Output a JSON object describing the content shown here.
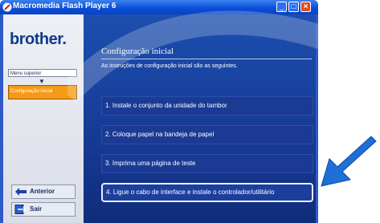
{
  "window": {
    "title": "Macromedia Flash Player 6",
    "title_colors": {
      "bar": "#0a4fd8",
      "close": "#e24b22"
    }
  },
  "sidebar": {
    "logo": "brother.",
    "menu_top_label": "Menu superior",
    "menu_active_label": "Configuração inicial",
    "back_button": "Anterior",
    "exit_button": "Sair"
  },
  "main": {
    "heading": "Configuração inicial",
    "subtitle": "As instruções de configuração inicial são as seguintes.",
    "steps": [
      {
        "label": "1. Instale o conjunto da unidade do tambor"
      },
      {
        "label": "2. Coloque papel na bandeja de papel"
      },
      {
        "label": "3. Imprima uma página de teste"
      },
      {
        "label": "4. Ligue o cabo de interface e instale o controlador/utilitário"
      }
    ]
  },
  "colors": {
    "accent_orange": "#f59a16",
    "pointer_blue": "#1e6fd6",
    "panel_blue": "#163a94"
  }
}
